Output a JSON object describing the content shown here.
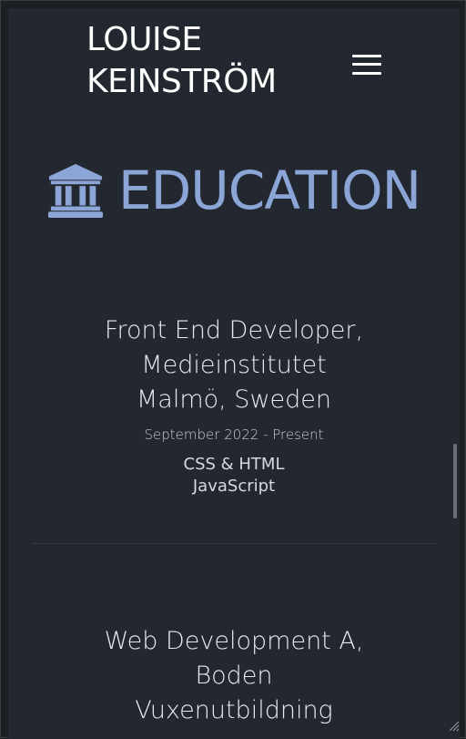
{
  "header": {
    "brand_line1": "LOUISE",
    "brand_line2": "KEINSTRÖM",
    "menu_icon": "hamburger-menu-icon"
  },
  "section": {
    "title": "EDUCATION",
    "icon": "institution-icon",
    "accent_color": "#8aa5d6"
  },
  "entries": [
    {
      "title_lines": [
        "Front End Developer,",
        "Medieinstitutet",
        "Malmö, Sweden"
      ],
      "date": "September 2022 - Present",
      "skills": [
        "CSS & HTML",
        "JavaScript"
      ]
    },
    {
      "title_lines": [
        "Web Development A,",
        "Boden",
        "Vuxenutbildning"
      ]
    }
  ],
  "colors": {
    "background": "#232830",
    "text": "#e7e9ee"
  }
}
